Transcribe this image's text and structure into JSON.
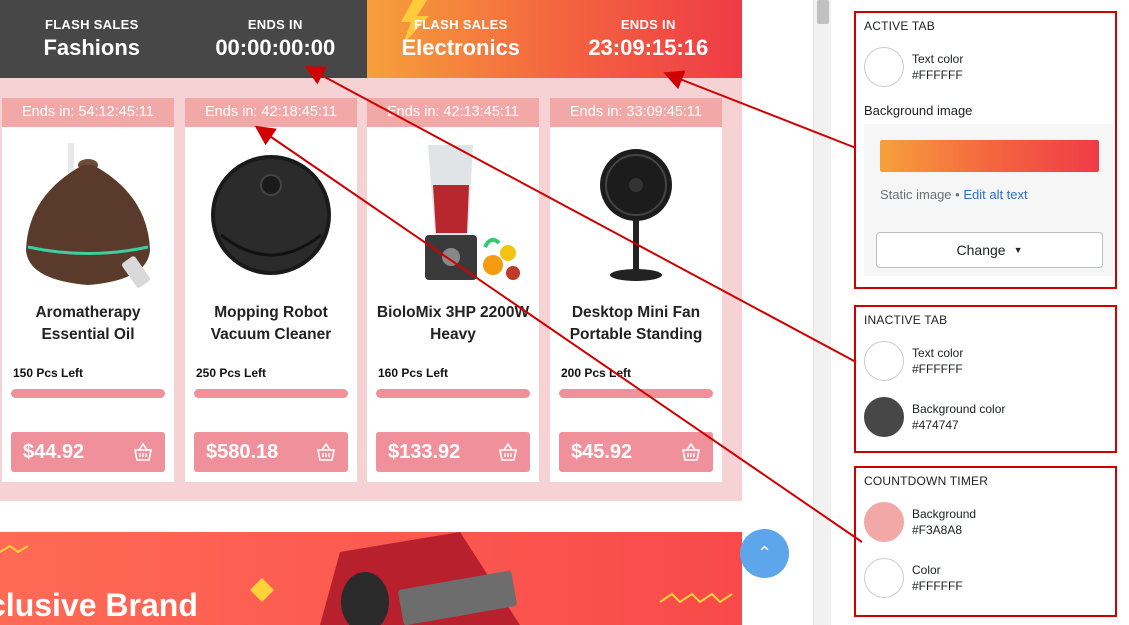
{
  "flash": {
    "inactive_tab": {
      "small_label": "FLASH SALES",
      "title": "Fashions",
      "ends_label": "ENDS IN",
      "timer": "00:00:00:00"
    },
    "active_tab": {
      "small_label": "FLASH SALES",
      "title": "Electronics",
      "ends_label": "ENDS IN",
      "timer": "23:09:15:16"
    }
  },
  "products": [
    {
      "timer": "Ends in: 54:12:45:11",
      "name": "Aromatherapy Essential Oil",
      "left": "150 Pcs Left",
      "price": "$44.92",
      "icon": "diffuser-image"
    },
    {
      "timer": "Ends in: 42:18:45:11",
      "name": "Mopping Robot Vacuum Cleaner",
      "left": "250 Pcs Left",
      "price": "$580.18",
      "icon": "robot-vacuum-image"
    },
    {
      "timer": "Ends in: 42:13:45:11",
      "name": "BioloMix 3HP 2200W Heavy",
      "left": "160 Pcs Left",
      "price": "$133.92",
      "icon": "blender-image"
    },
    {
      "timer": "Ends in: 33:09:45:11",
      "name": "Desktop Mini Fan Portable Standing",
      "left": "200 Pcs Left",
      "price": "$45.92",
      "icon": "fan-image"
    }
  ],
  "banner": {
    "text": "clusive Brand"
  },
  "settings": {
    "active_tab": {
      "title": "ACTIVE TAB",
      "text_color_label": "Text color",
      "text_color": "#FFFFFF",
      "bg_image_label": "Background image",
      "static_image": "Static image •",
      "edit_alt": "Edit alt text",
      "change_label": "Change"
    },
    "inactive_tab": {
      "title": "INACTIVE TAB",
      "text_color_label": "Text color",
      "text_color": "#FFFFFF",
      "bg_color_label": "Background color",
      "bg_color": "#474747"
    },
    "countdown": {
      "title": "COUNTDOWN TIMER",
      "bg_label": "Background",
      "bg_color": "#F3A8A8",
      "color_label": "Color",
      "color": "#FFFFFF"
    }
  },
  "colors": {
    "annotation": "#d10000",
    "accent_pink": "#f0909a",
    "scroll_top": "#5ea6ec"
  }
}
